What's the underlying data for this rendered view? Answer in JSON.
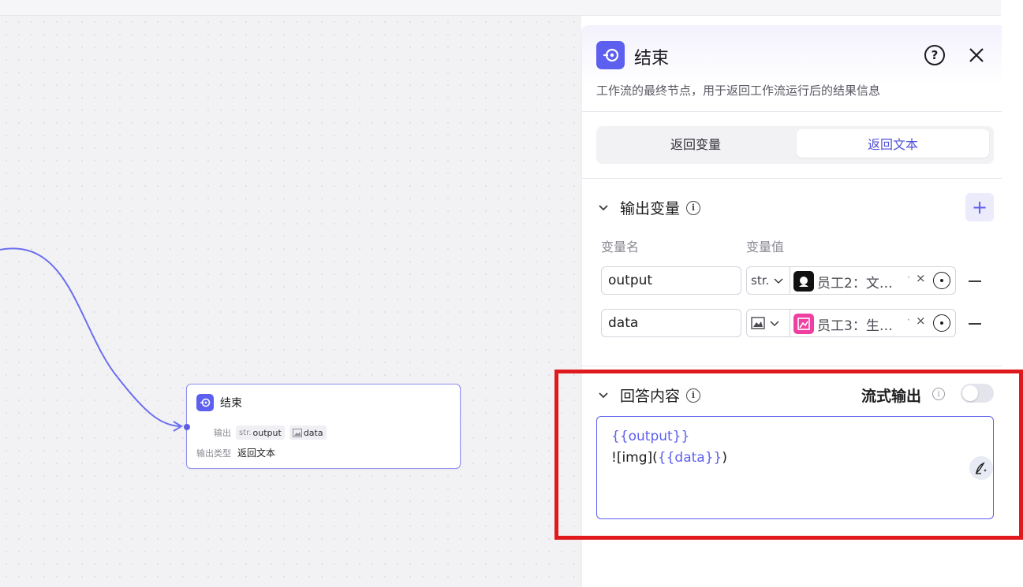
{
  "canvas": {
    "node": {
      "title": "结束",
      "output_label": "输出",
      "outputs": [
        {
          "type_tag": "str.",
          "name": "output"
        },
        {
          "type_tag": "",
          "name": "data"
        }
      ],
      "output_type_label": "输出类型",
      "output_type_value": "返回文本"
    }
  },
  "panel": {
    "title": "结束",
    "help_icon": "question-circle-icon",
    "close_icon": "close-icon",
    "description": "工作流的最终节点，用于返回工作流运行后的结果信息",
    "tabs": [
      "返回变量",
      "返回文本"
    ],
    "active_tab": "返回文本",
    "output_section": {
      "title": "输出变量",
      "col_name": "变量名",
      "col_value": "变量值",
      "rows": [
        {
          "name": "output",
          "type": "str.",
          "ref": "员工2：文…",
          "ref_color": "#111111"
        },
        {
          "name": "data",
          "type": "",
          "ref": "员工3：生…",
          "ref_color": "#ee3fa2"
        }
      ]
    },
    "answer_section": {
      "title": "回答内容",
      "stream_label": "流式输出",
      "stream_enabled": false,
      "line1_var": "{{output}}",
      "line2_prefix": "![img](",
      "line2_var": "{{data}}",
      "line2_suffix": ")"
    }
  },
  "colors": {
    "accent": "#5d5fef",
    "highlight": "#e0191d"
  }
}
